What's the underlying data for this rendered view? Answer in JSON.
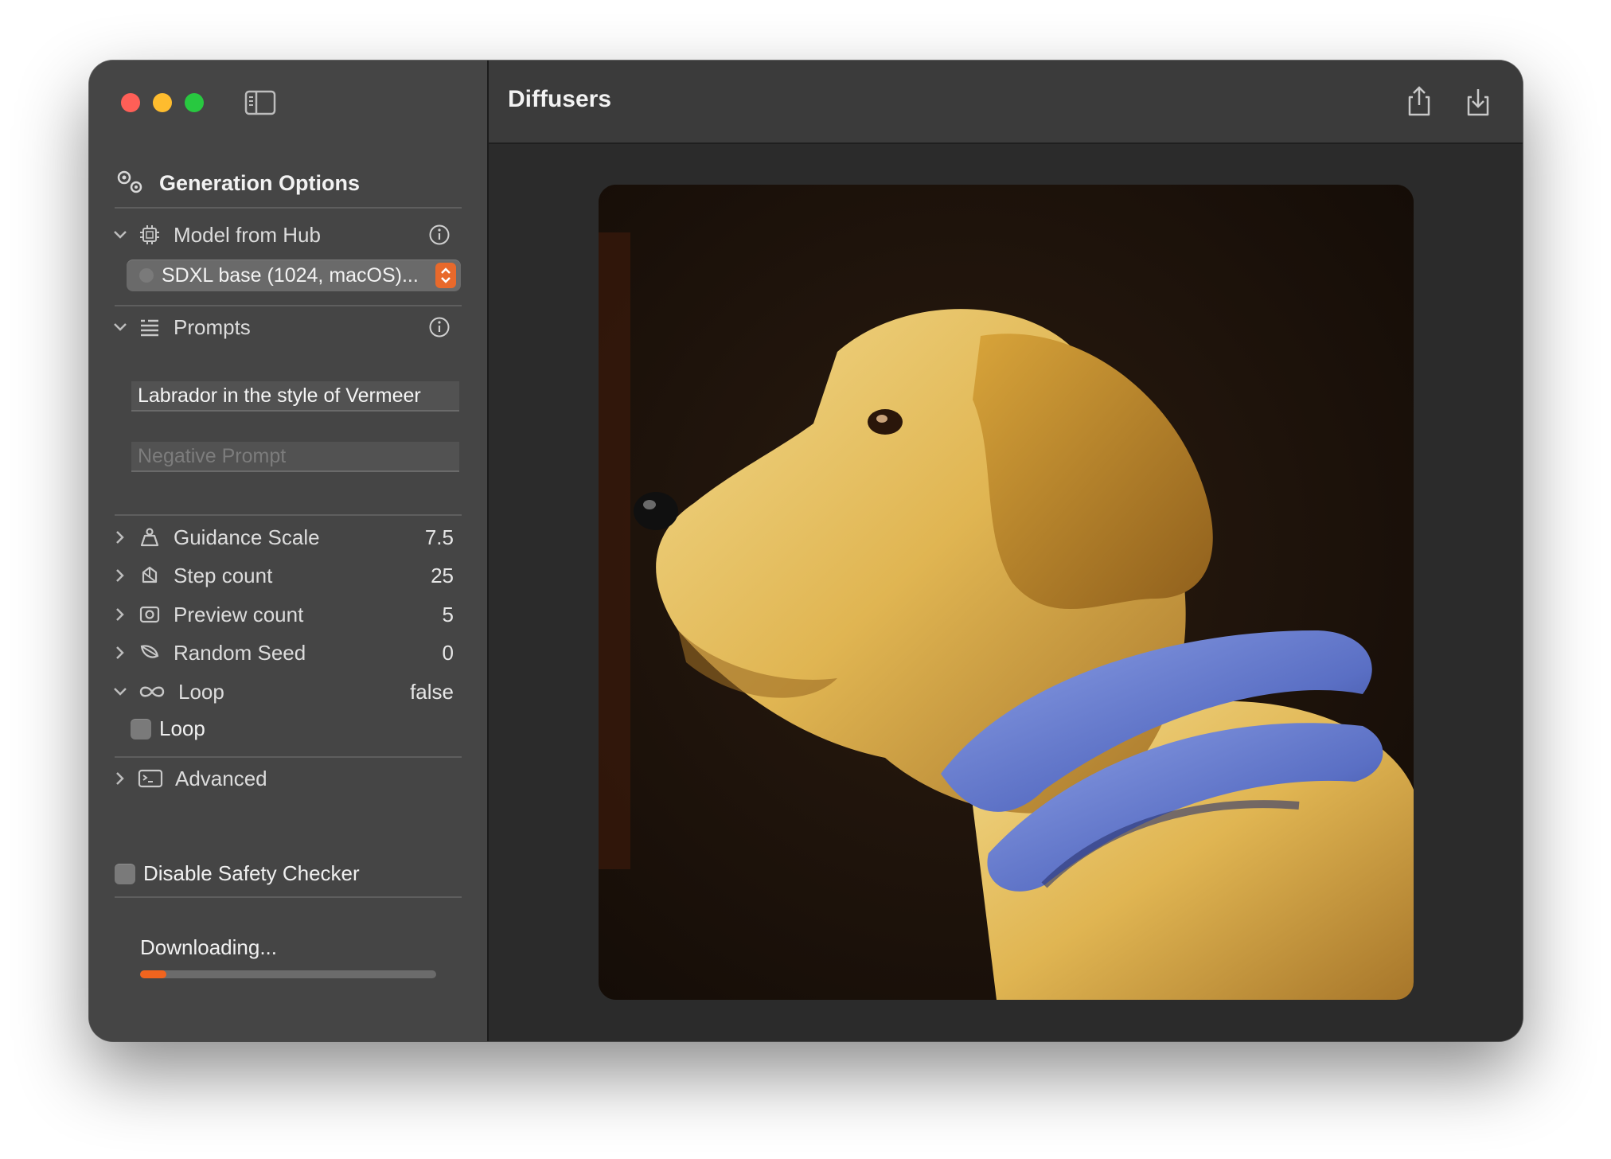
{
  "window": {
    "title": "Diffusers"
  },
  "sidebar": {
    "section_title": "Generation Options",
    "model": {
      "label": "Model from Hub",
      "selected": "SDXL base (1024, macOS)..."
    },
    "prompts": {
      "label": "Prompts",
      "prompt_value": "Labrador in the style of Vermeer",
      "negative_placeholder": "Negative Prompt"
    },
    "params": [
      {
        "label": "Guidance Scale",
        "value": "7.5",
        "icon": "guidance-icon"
      },
      {
        "label": "Step count",
        "value": "25",
        "icon": "steps-icon"
      },
      {
        "label": "Preview count",
        "value": "5",
        "icon": "preview-icon"
      },
      {
        "label": "Random Seed",
        "value": "0",
        "icon": "seed-icon"
      },
      {
        "label": "Loop",
        "value": "false",
        "icon": "infinity-icon"
      }
    ],
    "loop_checkbox": "Loop",
    "advanced": "Advanced",
    "safety_checkbox": "Disable Safety Checker",
    "status": "Downloading...",
    "progress": 0.09
  },
  "image": {
    "description_icon": "generated-image",
    "accent": "#e8692b"
  }
}
